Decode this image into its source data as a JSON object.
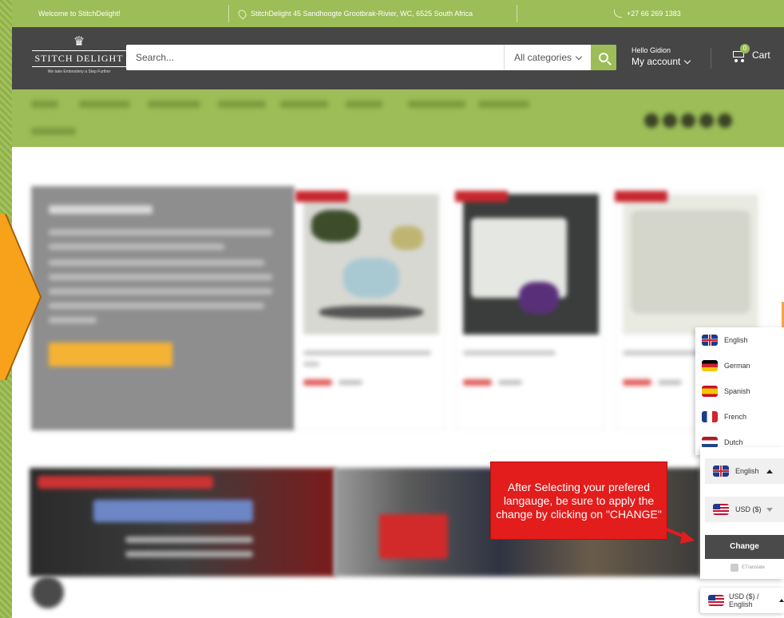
{
  "topbar": {
    "welcome": "Welcome to StitchDelight!",
    "address": "StitchDelight 45 Sandhoogte Grootbrak-Rivier, WC, 6525 South Africa",
    "phone": "+27 66 269 1383"
  },
  "header": {
    "logo_word": "STITCH DELIGHT",
    "logo_tagline": "We take Embroidery a Step Further",
    "search_placeholder": "Search...",
    "category": "All categories",
    "account_greeting": "Hello Gidion",
    "account_label": "My account",
    "cart_count": "0",
    "cart_label": "Cart"
  },
  "language_menu": {
    "options": [
      "English",
      "German",
      "Spanish",
      "French",
      "Dutch"
    ],
    "selected_language": "English",
    "selected_currency": "USD ($)",
    "change_label": "Change",
    "powered_by": "ETranslate",
    "summary": "USD ($) / English"
  },
  "callout": {
    "text": "After Selecting your prefered langauge, be sure to apply the change by clicking on \"CHANGE\""
  },
  "colors": {
    "brand_green": "#9cbd57",
    "header_dark": "#464646",
    "callout_red": "#e31c1c",
    "arrow_orange": "#f7a21a"
  }
}
